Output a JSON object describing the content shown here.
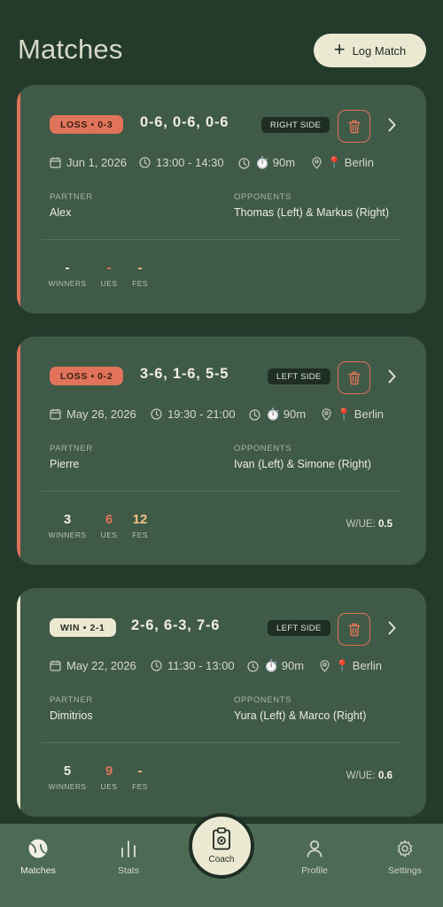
{
  "header": {
    "title": "Matches",
    "log_button": "Log Match"
  },
  "labels": {
    "partner": "PARTNER",
    "opponents": "OPPONENTS",
    "winners": "WINNERS",
    "ues": "UES",
    "fes": "FES",
    "wue": "W/UE:"
  },
  "matches": [
    {
      "result": "LOSS • 0-3",
      "result_type": "loss",
      "score": "0-6, 0-6, 0-6",
      "side": "RIGHT SIDE",
      "date": "Jun 1, 2026",
      "time": "13:00 - 14:30",
      "duration": "⏱️ 90m",
      "location": "📍 Berlin",
      "partner": "Alex",
      "opponents": "Thomas (Left) & Markus (Right)",
      "winners": "-",
      "ues": "-",
      "fes": "-",
      "wue": ""
    },
    {
      "result": "LOSS • 0-2",
      "result_type": "loss",
      "score": "3-6, 1-6, 5-5",
      "side": "LEFT SIDE",
      "date": "May 26, 2026",
      "time": "19:30 - 21:00",
      "duration": "⏱️ 90m",
      "location": "📍 Berlin",
      "partner": "Pierre",
      "opponents": "Ivan (Left) & Simone (Right)",
      "winners": "3",
      "ues": "6",
      "fes": "12",
      "wue": "0.5"
    },
    {
      "result": "WIN • 2-1",
      "result_type": "win",
      "score": "2-6, 6-3, 7-6",
      "side": "LEFT SIDE",
      "date": "May 22, 2026",
      "time": "11:30 - 13:00",
      "duration": "⏱️ 90m",
      "location": "📍 Berlin",
      "partner": "Dimitrios",
      "opponents": "Yura (Left) & Marco (Right)",
      "winners": "5",
      "ues": "9",
      "fes": "-",
      "wue": "0.6"
    }
  ],
  "nav": {
    "matches": "Matches",
    "stats": "Stats",
    "coach": "Coach",
    "profile": "Profile",
    "settings": "Settings"
  },
  "colors": {
    "background": "#243b2c",
    "card": "#3f5a47",
    "loss": "#e0735a",
    "win": "#ece9d3",
    "ue_number": "#e0735a",
    "fe_number": "#f0c08a"
  }
}
